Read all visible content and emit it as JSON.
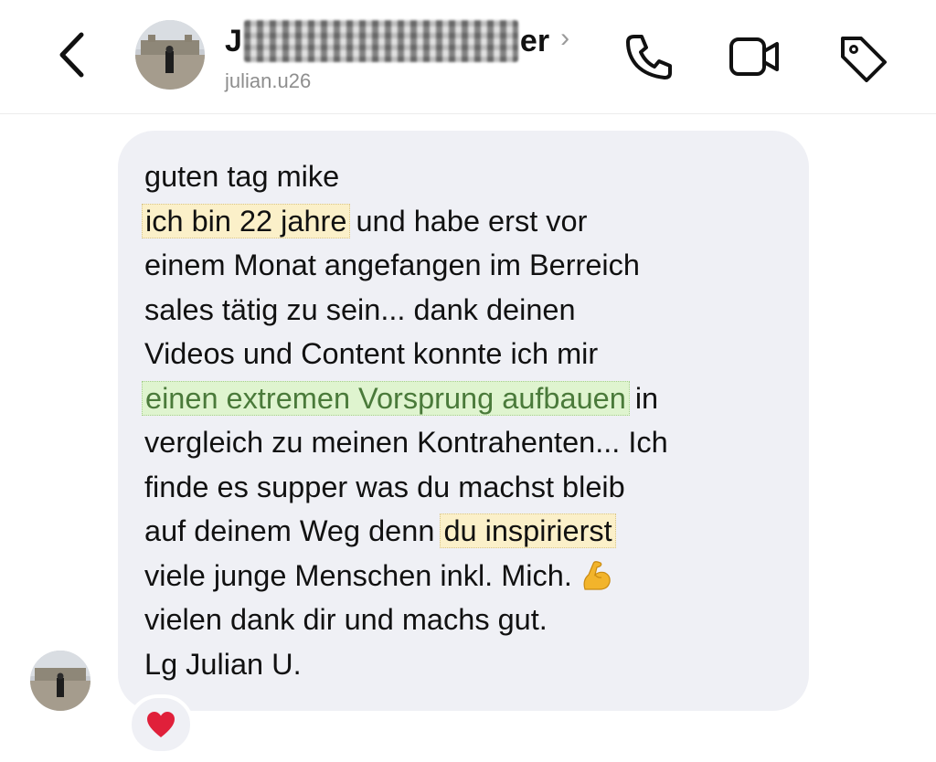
{
  "header": {
    "name_start": "J",
    "name_end": "er",
    "chevron": "›",
    "username": "julian.u26",
    "icons": [
      "back-icon",
      "phone-icon",
      "video-icon",
      "tag-icon"
    ]
  },
  "message": {
    "lines": [
      {
        "text": "guten tag mike"
      },
      {
        "highlight": "ich bin 22 jahre",
        "after": " und habe erst vor"
      },
      {
        "text": "einem Monat angefangen im Berreich"
      },
      {
        "text": "sales tätig zu sein... dank deinen"
      },
      {
        "text": "Videos und Content konnte ich mir"
      },
      {
        "highlight": "einen extremen Vorsprung aufbauen",
        "after": " in"
      },
      {
        "text": "vergleich zu meinen Kontrahenten... Ich"
      },
      {
        "text": "finde es supper was du machst bleib"
      },
      {
        "before": "auf deinem Weg denn ",
        "highlight": "du inspirierst"
      },
      {
        "text": "viele junge Menschen inkl. Mich."
      },
      {
        "text": "vielen dank dir und machs gut."
      },
      {
        "text": "Lg Julian U."
      }
    ],
    "emoji": "flexed-biceps-icon",
    "reaction": "heart-icon"
  },
  "colors": {
    "bubble": "#eff0f5",
    "highlight_yellow": "#fbf0c9",
    "highlight_green": "#dff4cf",
    "green_text": "#4a7a3a",
    "heart": "#e0203a",
    "muted": "#8e8e8e"
  }
}
